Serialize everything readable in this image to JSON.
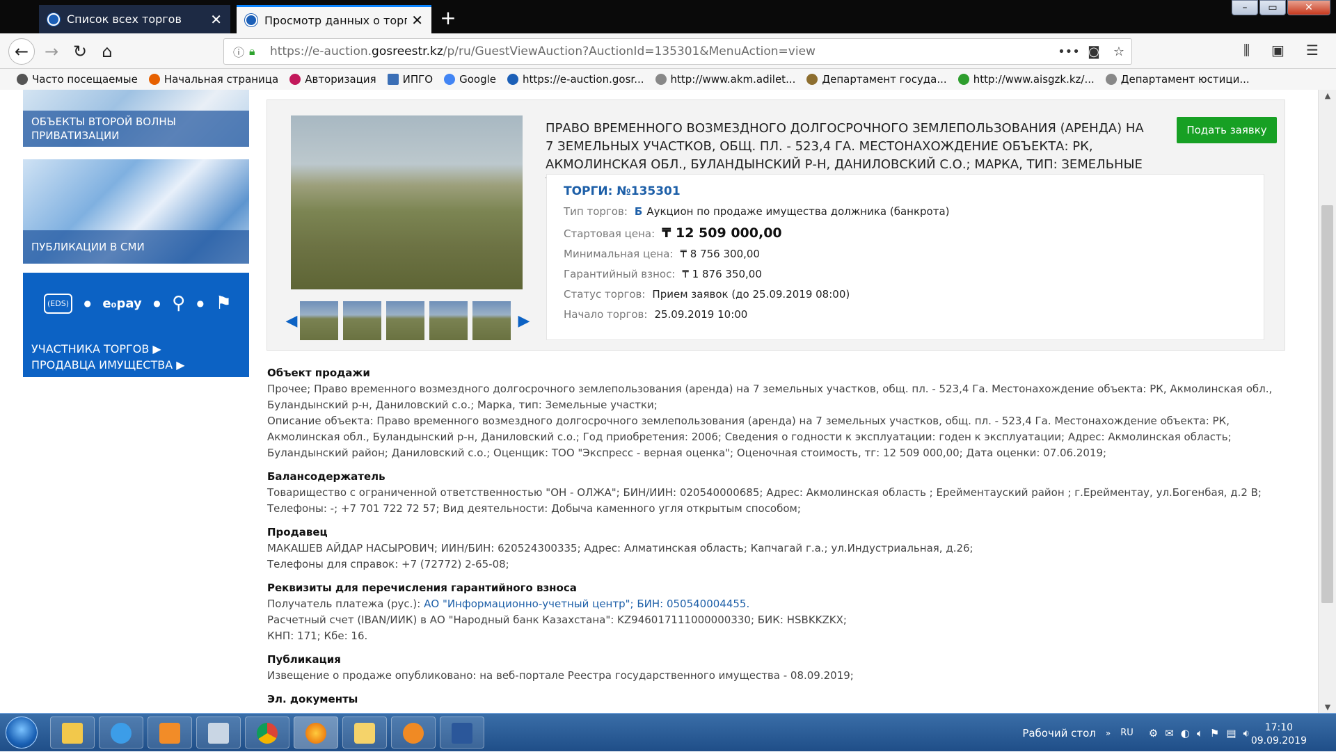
{
  "browser": {
    "tabs": [
      {
        "label": "Список всех торгов"
      },
      {
        "label": "Просмотр данных о торгах"
      }
    ],
    "url_prefix": "https://e-auction.",
    "url_domain": "gosreestr.kz",
    "url_rest": "/p/ru/GuestViewAuction?AuctionId=135301&MenuAction=view",
    "bookmarks": [
      {
        "label": "Часто посещаемые",
        "color": "#555555"
      },
      {
        "label": "Начальная страница",
        "color": "#e66000"
      },
      {
        "label": "Авторизация",
        "color": "#c2185b"
      },
      {
        "label": "ИПГО",
        "color": "#3b6fb6"
      },
      {
        "label": "Google",
        "color": "#4285f4"
      },
      {
        "label": "https://e-auction.gosr...",
        "color": "#1b5fb7"
      },
      {
        "label": "http://www.akm.adilet...",
        "color": "#888888"
      },
      {
        "label": "Департамент госуда...",
        "color": "#8d6e2f"
      },
      {
        "label": "http://www.aisgzk.kz/...",
        "color": "#2e9e2e"
      },
      {
        "label": "Департамент юстици...",
        "color": "#888888"
      }
    ]
  },
  "sidebar": {
    "card1": "ОБЪЕКТЫ ВТОРОЙ ВОЛНЫ ПРИВАТИЗАЦИИ",
    "card2": "ПУБЛИКАЦИИ В СМИ",
    "card3_link1": "УЧАСТНИКА ТОРГОВ ▶",
    "card3_link2": "ПРОДАВЦА ИМУЩЕСТВА ▶",
    "eds": "(EDS)",
    "epay": "e₀pay"
  },
  "lot": {
    "title": "ПРАВО ВРЕМЕННОГО ВОЗМЕЗДНОГО ДОЛГОСРОЧНОГО ЗЕМЛЕПОЛЬЗОВАНИЯ (АРЕНДА) НА 7 ЗЕМЕЛЬНЫХ УЧАСТКОВ, ОБЩ. ПЛ. - 523,4 ГА. МЕСТОНАХОЖДЕНИЕ ОБЪЕКТА: РК, АКМОЛИНСКАЯ ОБЛ., БУЛАНДЫНСКИЙ Р-Н, ДАНИЛОВСКИЙ С.О.; МАРКА, ТИП: ЗЕМЕЛЬНЫЕ УЧАСТКИ",
    "apply_button": "Подать заявку",
    "auction_number": "ТОРГИ: №135301",
    "type_label": "Тип торгов:",
    "type_badge": "Б",
    "type_value": "Аукцион по продаже имущества должника (банкрота)",
    "start_price_label": "Стартовая цена:",
    "start_price": "₸ 12 509 000,00",
    "min_price_label": "Минимальная цена:",
    "min_price": "₸ 8 756 300,00",
    "deposit_label": "Гарантийный взнос:",
    "deposit": "₸ 1 876 350,00",
    "status_label": "Статус торгов:",
    "status": "Прием заявок (до 25.09.2019 08:00)",
    "start_label": "Начало торгов:",
    "start": "25.09.2019 10:00"
  },
  "details": {
    "object_h": "Объект продажи",
    "object_p1": "Прочее; Право временного возмездного долгосрочного землепользования (аренда) на 7 земельных участков, общ. пл. - 523,4 Га. Местонахождение объекта: РК, Акмолинская обл., Буландынский р-н, Даниловский с.о.; Марка, тип: Земельные участки;",
    "object_p2": "Описание объекта: Право временного возмездного долгосрочного землепользования (аренда) на 7 земельных участков, общ. пл. - 523,4 Га. Местонахождение объекта: РК, Акмолинская обл., Буландынский р-н, Даниловский с.о.; Год приобретения: 2006; Сведения о годности к эксплуатации: годен к эксплуатации; Адрес: Акмолинская область; Буландынский район; Даниловский с.о.; Оценщик: ТОО \"Экспресс - верная оценка\"; Оценочная стоимость, тг: 12 509 000,00; Дата оценки: 07.06.2019;",
    "holder_h": "Балансодержатель",
    "holder_p": "Товарищество с ограниченной ответственностью \"ОН - ОЛЖА\"; БИН/ИИН: 020540000685; Адрес: Акмолинская область ; Ерейментауский район ; г.Ерейментау, ул.Богенбая, д.2 В; Телефоны: -; +7 701 722 72 57; Вид деятельности: Добыча каменного угля открытым способом;",
    "seller_h": "Продавец",
    "seller_p1": "МАКАШЕВ АЙДАР НАСЫРОВИЧ; ИИН/БИН: 620524300335;  Адрес: Алматинская область; Капчагай г.а.; ул.Индустриальная, д.26;",
    "seller_p2": "Телефоны для справок: +7 (72772) 2-65-08;",
    "req_h": "Реквизиты для перечисления гарантийного взноса",
    "req_p1_prefix": "Получатель платежа (рус.): ",
    "req_p1_link": "АО \"Информационно-учетный центр\"; БИН: 050540004455.",
    "req_p2": "Расчетный счет (IBAN/ИИК) в АО \"Народный банк Казахстана\": KZ946017111000000330; БИК: HSBKKZKX;",
    "req_p3": "КНП: 171; Кбе: 16.",
    "pub_h": "Публикация",
    "pub_p": "Извещение о продаже опубликовано: на веб-портале Реестра государственного имущества - 08.09.2019;",
    "docs_h": "Эл. документы"
  },
  "taskbar": {
    "desktop_label": "Рабочий стол",
    "lang": "RU",
    "time": "17:10",
    "date": "09.09.2019"
  }
}
